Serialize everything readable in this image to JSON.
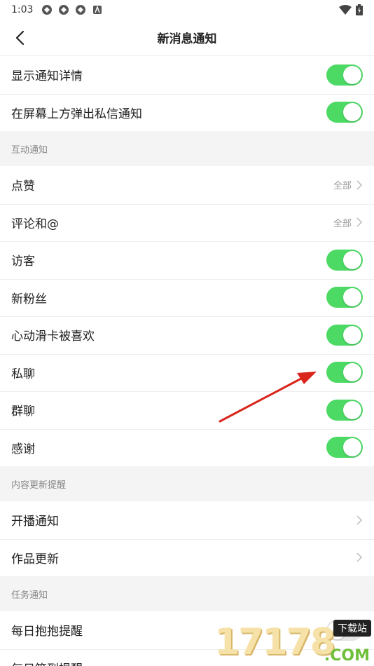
{
  "status_bar": {
    "time": "1:03"
  },
  "nav": {
    "title": "新消息通知"
  },
  "top_rows": [
    {
      "label": "显示通知详情",
      "toggle": true
    },
    {
      "label": "在屏幕上方弹出私信通知",
      "toggle": true
    }
  ],
  "sections": [
    {
      "header": "互动通知",
      "rows": [
        {
          "label": "点赞",
          "value": "全部"
        },
        {
          "label": "评论和@",
          "value": "全部"
        },
        {
          "label": "访客",
          "toggle": true
        },
        {
          "label": "新粉丝",
          "toggle": true
        },
        {
          "label": "心动滑卡被喜欢",
          "toggle": true
        },
        {
          "label": "私聊",
          "toggle": true
        },
        {
          "label": "群聊",
          "toggle": true
        },
        {
          "label": "感谢",
          "toggle": true
        }
      ]
    },
    {
      "header": "内容更新提醒",
      "rows": [
        {
          "label": "开播通知"
        },
        {
          "label": "作品更新"
        }
      ]
    },
    {
      "header": "任务通知",
      "rows": [
        {
          "label": "每日抱抱提醒",
          "toggle": false
        },
        {
          "label": "每日签到提醒"
        }
      ]
    }
  ],
  "watermark": {
    "digits": "17178",
    "badge": "下载站",
    "suffix": ".COM"
  },
  "colors": {
    "toggle_on": "#4cd964",
    "annotation_arrow": "#d9251c"
  }
}
